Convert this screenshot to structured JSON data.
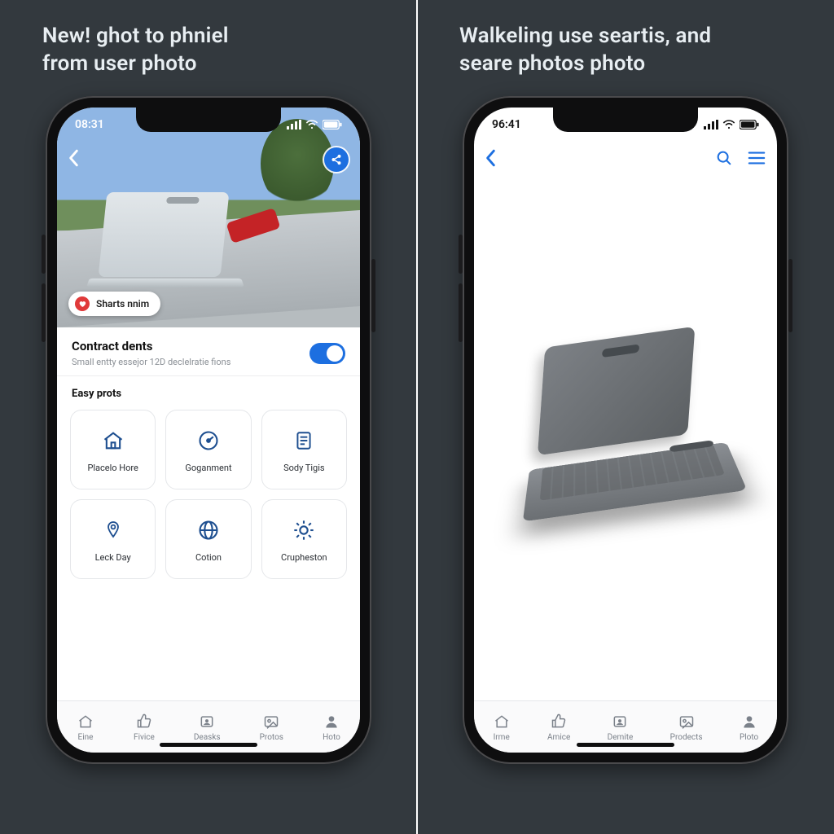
{
  "panels": {
    "left": {
      "headline": "New! ghot to phniel\nfrom user photo"
    },
    "right": {
      "headline": "Walkeling use seartis, and\nseare photos photo"
    }
  },
  "left_phone": {
    "status": {
      "time": "08:31"
    },
    "hero": {
      "pill_label": "Sharts nnim"
    },
    "card": {
      "title": "Contract dents",
      "subtitle": "Small entty essejor 12D declelratie fions",
      "toggle_on": true
    },
    "easy": {
      "title": "Easy prots",
      "tiles": [
        {
          "id": "placelo-hore",
          "label": "Placelo Hore"
        },
        {
          "id": "goganment",
          "label": "Goganment"
        },
        {
          "id": "sody-tigis",
          "label": "Sody Tigis"
        },
        {
          "id": "leck-day",
          "label": "Leck Day"
        },
        {
          "id": "cotion",
          "label": "Cotion"
        },
        {
          "id": "crupheston",
          "label": "Crupheston"
        }
      ]
    },
    "tabs": [
      {
        "id": "eine",
        "label": "Eine"
      },
      {
        "id": "fivice",
        "label": "Fivice"
      },
      {
        "id": "deasks",
        "label": "Deasks"
      },
      {
        "id": "protos",
        "label": "Protos"
      },
      {
        "id": "hoto",
        "label": "Hoto"
      }
    ]
  },
  "right_phone": {
    "status": {
      "time": "96:41"
    },
    "tabs": [
      {
        "id": "irme",
        "label": "Irme"
      },
      {
        "id": "amice",
        "label": "Amice"
      },
      {
        "id": "demite",
        "label": "Demite"
      },
      {
        "id": "prodects",
        "label": "Prodects"
      },
      {
        "id": "ploto",
        "label": "Ploto"
      }
    ]
  }
}
